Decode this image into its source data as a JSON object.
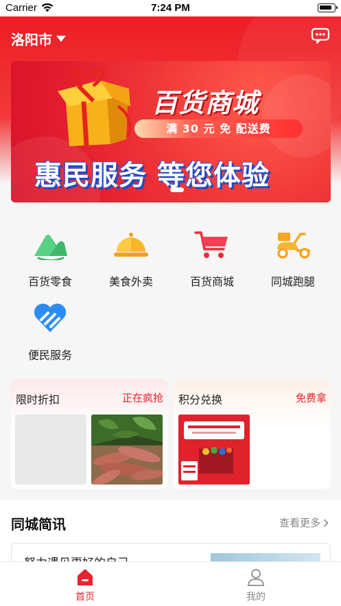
{
  "status_bar": {
    "carrier": "Carrier",
    "time": "7:24 PM"
  },
  "header": {
    "city": "洛阳市",
    "message_icon": "chat-bubble-icon"
  },
  "banner": {
    "title": "百货商城",
    "pill": "满 30 元 免 配送费",
    "slogan": "惠民服务 等您体验"
  },
  "categories": [
    {
      "label": "百货零食",
      "icon": "mountain-icon"
    },
    {
      "label": "美食外卖",
      "icon": "food-cloche-icon"
    },
    {
      "label": "百货商城",
      "icon": "shopping-cart-icon"
    },
    {
      "label": "同城跑腿",
      "icon": "scooter-icon"
    },
    {
      "label": "便民服务",
      "icon": "heart-handshake-icon"
    }
  ],
  "promos": {
    "left": {
      "title": "限时折扣",
      "tag": "正在疯抢"
    },
    "right": {
      "title": "积分兑换",
      "tag": "免费拿"
    }
  },
  "news": {
    "title": "同城简讯",
    "more": "查看更多",
    "first_item": "努力遇见更好的自己"
  },
  "tabs": [
    {
      "label": "首页",
      "icon": "home-icon",
      "active": true
    },
    {
      "label": "我的",
      "icon": "user-icon",
      "active": false
    }
  ],
  "colors": {
    "primary": "#e8232b",
    "tab_inactive": "#888888"
  }
}
